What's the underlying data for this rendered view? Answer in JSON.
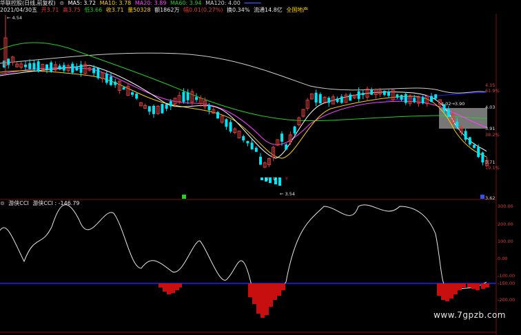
{
  "header": {
    "title": "华联控股(日线,前复权)",
    "ma5": "MA5: 3.72",
    "ma10": "MA10: 3.78",
    "ma20": "MA20: 3.89",
    "ma60": "MA60: 3.94",
    "ma120": "MA120: 4.00",
    "date": "2021/04/30五",
    "open": "开3.71",
    "high": "高3.75",
    "low": "低3.66",
    "close": "收3.71",
    "volume": "量50328",
    "amount": "额1862万",
    "change": "幅0.01(0.27%)",
    "turnover": "换0.34%",
    "float_cap": "流通14.8亿",
    "concept": "全国地产"
  },
  "price_panel": {
    "high_label": "4.54",
    "low_label": "3.54",
    "range_label": "4.02→3.90",
    "tags": [
      "U",
      "U",
      "Y"
    ],
    "right_axis": [
      {
        "value": "4.15",
        "color": "#e03c3c"
      },
      {
        "value": "61.9%",
        "color": "#e03c3c"
      },
      {
        "value": "4.03",
        "color": "#dcdcdc"
      },
      {
        "value": "3.91",
        "color": "#dcdcdc"
      },
      {
        "value": "38.2%",
        "color": "#e03c3c"
      },
      {
        "value": "3.71",
        "color": "#dcdcdc"
      },
      {
        "value": "19.1%",
        "color": "#e03c3c"
      },
      {
        "value": "3.62",
        "color": "#dcdcdc"
      }
    ]
  },
  "cci_panel": {
    "title": "游侠CCI",
    "value": "游侠CCI : -146.79",
    "right_axis": [
      "300.00",
      "200.00",
      "100.00",
      "0.00",
      "-100.00",
      "-150.00",
      "-200.00"
    ]
  },
  "colors": {
    "up": "#e03c3c",
    "down": "#00e5f5",
    "ma5": "#ffffff",
    "ma10": "#ffd000",
    "ma20": "#ff3dff",
    "ma60": "#1fd31f",
    "ma120": "#cfcfcf",
    "baseline": "#2020ff"
  },
  "watermark": "www.7gpzb.com"
}
